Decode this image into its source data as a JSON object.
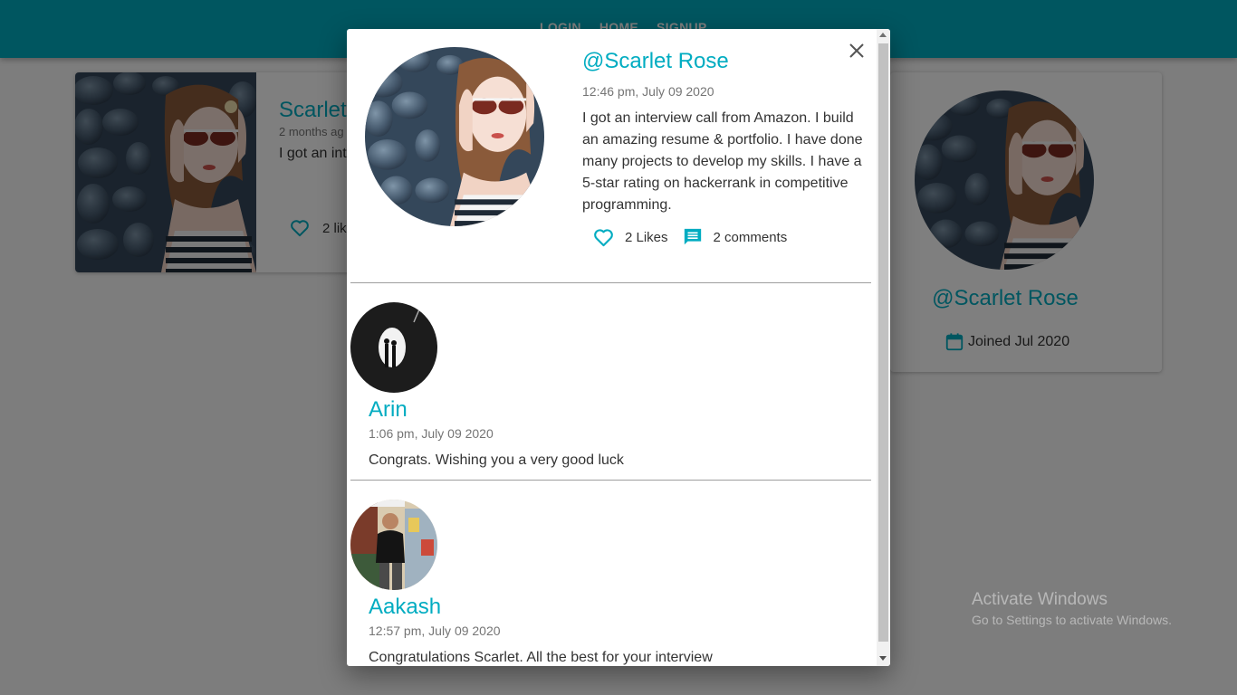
{
  "nav": {
    "links": [
      "LOGIN",
      "HOME",
      "SIGNUP"
    ]
  },
  "post_card": {
    "author": "Scarlet",
    "time": "2 months ag",
    "text": "I got an int portfolio. I rating on h",
    "likes": "2 lik"
  },
  "profile_card": {
    "name": "@Scarlet Rose",
    "joined": "Joined Jul 2020"
  },
  "modal": {
    "author": "@Scarlet Rose",
    "time": "12:46 pm, July 09 2020",
    "text": "I got an interview call from Amazon. I build an amazing resume & portfolio. I have done many projects to develop my skills. I have a 5-star rating on hackerrank in competitive programming.",
    "likes": "2 Likes",
    "comments_count": "2 comments",
    "comments": [
      {
        "name": "Arin",
        "time": "1:06 pm, July 09 2020",
        "text": "Congrats. Wishing you a very good luck"
      },
      {
        "name": "Aakash",
        "time": "12:57 pm, July 09 2020",
        "text": "Congratulations Scarlet. All the best for your interview"
      }
    ]
  },
  "watermark": {
    "title": "Activate Windows",
    "subtitle": "Go to Settings to activate Windows."
  },
  "icons": {
    "like": "heart-outline-icon",
    "comment": "comment-bubble-icon",
    "calendar": "calendar-icon",
    "close": "close-icon"
  },
  "colors": {
    "primary": "#00acc1",
    "overlay": "rgba(0,0,0,0.5)",
    "text": "#333333",
    "muted": "#757575"
  }
}
